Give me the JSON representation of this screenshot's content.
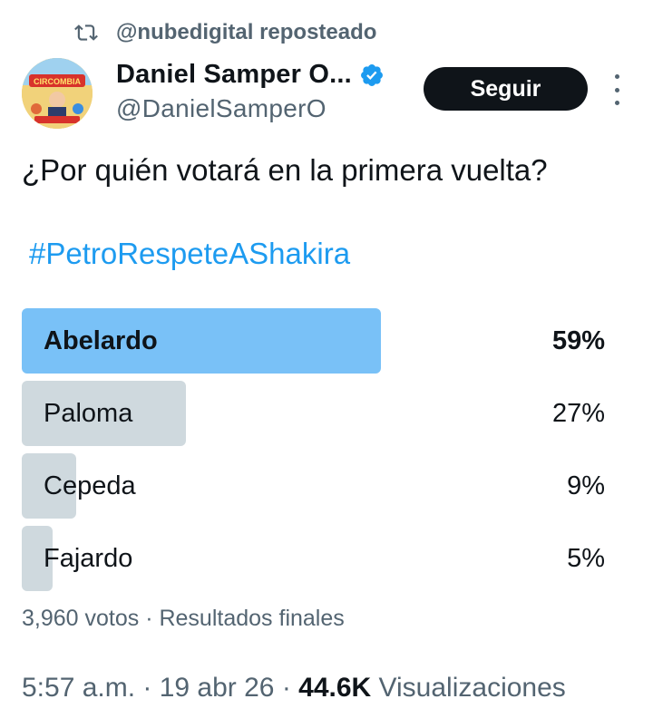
{
  "repost": {
    "text": "@nubedigital reposteado",
    "icon": "repost-icon"
  },
  "author": {
    "name": "Daniel Samper O...",
    "handle": "@DanielSamperO",
    "verified": true,
    "verified_color": "#1d9bf0",
    "avatar_text": "CIRCOMBIA"
  },
  "follow_label": "Seguir",
  "tweet": {
    "text": "¿Por quién votará en la primera vuelta?",
    "hashtag": "#PetroRespeteAShakira"
  },
  "poll": {
    "options": [
      {
        "label": "Abelardo",
        "percent": 59,
        "percent_label": "59%",
        "winner": true
      },
      {
        "label": "Paloma",
        "percent": 27,
        "percent_label": "27%",
        "winner": false
      },
      {
        "label": "Cepeda",
        "percent": 9,
        "percent_label": "9%",
        "winner": false
      },
      {
        "label": "Fajardo",
        "percent": 5,
        "percent_label": "5%",
        "winner": false
      }
    ],
    "meta": "3,960 votos · Resultados finales",
    "winner_color": "#79c1f7",
    "bar_color": "#cfd9de"
  },
  "footer": {
    "time": "5:57 a.m. · 19 abr 26 · ",
    "views_count": "44.6K",
    "views_label": " Visualizaciones"
  }
}
